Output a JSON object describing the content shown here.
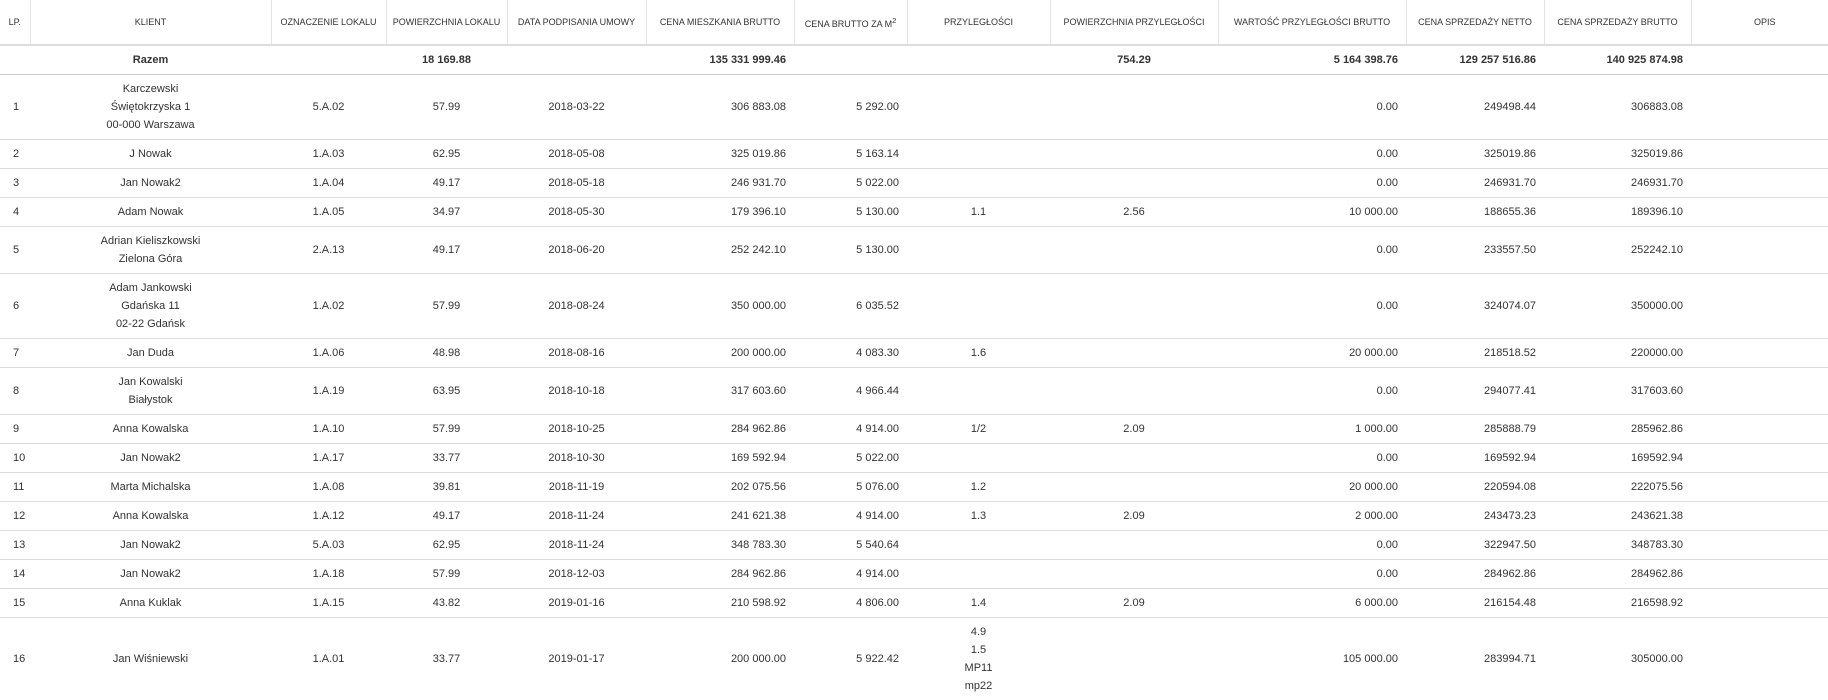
{
  "headers": {
    "lp": "LP.",
    "klient": "KLIENT",
    "oznaczenie": "OZNACZENIE LOKALU",
    "powierzchnia": "POWIERZCHNIA LOKALU",
    "data": "DATA PODPISANIA UMOWY",
    "cena_mieszkania": "CENA MIESZKANIA BRUTTO",
    "cena_m2": "CENA BRUTTO ZA M",
    "cena_m2_sup": "2",
    "przyleglosci": "PRZYLEGŁOŚCI",
    "pow_przyl": "POWIERZCHNIA PRZYLEGŁOŚCI",
    "wartosc_przyl": "WARTOŚĆ PRZYLEGŁOŚCI BRUTTO",
    "netto": "CENA SPRZEDAŻY NETTO",
    "brutto": "CENA SPRZEDAŻY BRUTTO",
    "opis": "OPIS"
  },
  "summary": {
    "label": "Razem",
    "powierzchnia": "18 169.88",
    "cena_mieszkania": "135 331 999.46",
    "pow_przyl": "754.29",
    "wartosc_przyl": "5 164 398.76",
    "netto": "129 257 516.86",
    "brutto": "140 925 874.98"
  },
  "rows": [
    {
      "lp": "1",
      "klient": [
        "Karczewski",
        "Świętokrzyska 1",
        "00-000 Warszawa"
      ],
      "oznaczenie": "5.A.02",
      "powierzchnia": "57.99",
      "data": "2018-03-22",
      "cena": "306 883.08",
      "cena_m2": "5 292.00",
      "przyleglosci": [],
      "pow_przyl": "",
      "wartosc": "0.00",
      "netto": "249498.44",
      "brutto": "306883.08",
      "opis": ""
    },
    {
      "lp": "2",
      "klient": [
        "J Nowak"
      ],
      "oznaczenie": "1.A.03",
      "powierzchnia": "62.95",
      "data": "2018-05-08",
      "cena": "325 019.86",
      "cena_m2": "5 163.14",
      "przyleglosci": [],
      "pow_przyl": "",
      "wartosc": "0.00",
      "netto": "325019.86",
      "brutto": "325019.86",
      "opis": ""
    },
    {
      "lp": "3",
      "klient": [
        "Jan Nowak2"
      ],
      "oznaczenie": "1.A.04",
      "powierzchnia": "49.17",
      "data": "2018-05-18",
      "cena": "246 931.70",
      "cena_m2": "5 022.00",
      "przyleglosci": [],
      "pow_przyl": "",
      "wartosc": "0.00",
      "netto": "246931.70",
      "brutto": "246931.70",
      "opis": ""
    },
    {
      "lp": "4",
      "klient": [
        "Adam Nowak"
      ],
      "oznaczenie": "1.A.05",
      "powierzchnia": "34.97",
      "data": "2018-05-30",
      "cena": "179 396.10",
      "cena_m2": "5 130.00",
      "przyleglosci": [
        "1.1"
      ],
      "pow_przyl": "2.56",
      "wartosc": "10 000.00",
      "netto": "188655.36",
      "brutto": "189396.10",
      "opis": ""
    },
    {
      "lp": "5",
      "klient": [
        "Adrian Kieliszkowski",
        "Zielona Góra"
      ],
      "oznaczenie": "2.A.13",
      "powierzchnia": "49.17",
      "data": "2018-06-20",
      "cena": "252 242.10",
      "cena_m2": "5 130.00",
      "przyleglosci": [],
      "pow_przyl": "",
      "wartosc": "0.00",
      "netto": "233557.50",
      "brutto": "252242.10",
      "opis": ""
    },
    {
      "lp": "6",
      "klient": [
        "Adam Jankowski",
        "Gdańska 11",
        "02-22 Gdańsk"
      ],
      "oznaczenie": "1.A.02",
      "powierzchnia": "57.99",
      "data": "2018-08-24",
      "cena": "350 000.00",
      "cena_m2": "6 035.52",
      "przyleglosci": [],
      "pow_przyl": "",
      "wartosc": "0.00",
      "netto": "324074.07",
      "brutto": "350000.00",
      "opis": ""
    },
    {
      "lp": "7",
      "klient": [
        "Jan Duda"
      ],
      "oznaczenie": "1.A.06",
      "powierzchnia": "48.98",
      "data": "2018-08-16",
      "cena": "200 000.00",
      "cena_m2": "4 083.30",
      "przyleglosci": [
        "1.6"
      ],
      "pow_przyl": "",
      "wartosc": "20 000.00",
      "netto": "218518.52",
      "brutto": "220000.00",
      "opis": ""
    },
    {
      "lp": "8",
      "klient": [
        "Jan Kowalski",
        "Białystok"
      ],
      "oznaczenie": "1.A.19",
      "powierzchnia": "63.95",
      "data": "2018-10-18",
      "cena": "317 603.60",
      "cena_m2": "4 966.44",
      "przyleglosci": [],
      "pow_przyl": "",
      "wartosc": "0.00",
      "netto": "294077.41",
      "brutto": "317603.60",
      "opis": ""
    },
    {
      "lp": "9",
      "klient": [
        "Anna Kowalska"
      ],
      "oznaczenie": "1.A.10",
      "powierzchnia": "57.99",
      "data": "2018-10-25",
      "cena": "284 962.86",
      "cena_m2": "4 914.00",
      "przyleglosci": [
        "1/2"
      ],
      "pow_przyl": "2.09",
      "wartosc": "1 000.00",
      "netto": "285888.79",
      "brutto": "285962.86",
      "opis": ""
    },
    {
      "lp": "10",
      "klient": [
        "Jan Nowak2"
      ],
      "oznaczenie": "1.A.17",
      "powierzchnia": "33.77",
      "data": "2018-10-30",
      "cena": "169 592.94",
      "cena_m2": "5 022.00",
      "przyleglosci": [],
      "pow_przyl": "",
      "wartosc": "0.00",
      "netto": "169592.94",
      "brutto": "169592.94",
      "opis": ""
    },
    {
      "lp": "11",
      "klient": [
        "Marta Michalska"
      ],
      "oznaczenie": "1.A.08",
      "powierzchnia": "39.81",
      "data": "2018-11-19",
      "cena": "202 075.56",
      "cena_m2": "5 076.00",
      "przyleglosci": [
        "1.2"
      ],
      "pow_przyl": "",
      "wartosc": "20 000.00",
      "netto": "220594.08",
      "brutto": "222075.56",
      "opis": ""
    },
    {
      "lp": "12",
      "klient": [
        "Anna Kowalska"
      ],
      "oznaczenie": "1.A.12",
      "powierzchnia": "49.17",
      "data": "2018-11-24",
      "cena": "241 621.38",
      "cena_m2": "4 914.00",
      "przyleglosci": [
        "1.3"
      ],
      "pow_przyl": "2.09",
      "wartosc": "2 000.00",
      "netto": "243473.23",
      "brutto": "243621.38",
      "opis": ""
    },
    {
      "lp": "13",
      "klient": [
        "Jan Nowak2"
      ],
      "oznaczenie": "5.A.03",
      "powierzchnia": "62.95",
      "data": "2018-11-24",
      "cena": "348 783.30",
      "cena_m2": "5 540.64",
      "przyleglosci": [],
      "pow_przyl": "",
      "wartosc": "0.00",
      "netto": "322947.50",
      "brutto": "348783.30",
      "opis": ""
    },
    {
      "lp": "14",
      "klient": [
        "Jan Nowak2"
      ],
      "oznaczenie": "1.A.18",
      "powierzchnia": "57.99",
      "data": "2018-12-03",
      "cena": "284 962.86",
      "cena_m2": "4 914.00",
      "przyleglosci": [],
      "pow_przyl": "",
      "wartosc": "0.00",
      "netto": "284962.86",
      "brutto": "284962.86",
      "opis": ""
    },
    {
      "lp": "15",
      "klient": [
        "Anna Kuklak"
      ],
      "oznaczenie": "1.A.15",
      "powierzchnia": "43.82",
      "data": "2019-01-16",
      "cena": "210 598.92",
      "cena_m2": "4 806.00",
      "przyleglosci": [
        "1.4"
      ],
      "pow_przyl": "2.09",
      "wartosc": "6 000.00",
      "netto": "216154.48",
      "brutto": "216598.92",
      "opis": ""
    },
    {
      "lp": "16",
      "klient": [
        "Jan Wiśniewski"
      ],
      "oznaczenie": "1.A.01",
      "powierzchnia": "33.77",
      "data": "2019-01-17",
      "cena": "200 000.00",
      "cena_m2": "5 922.42",
      "przyleglosci": [
        "4.9",
        "1.5",
        "MP11",
        "mp22"
      ],
      "pow_przyl": "",
      "wartosc": "105 000.00",
      "netto": "283994.71",
      "brutto": "305000.00",
      "opis": ""
    }
  ]
}
